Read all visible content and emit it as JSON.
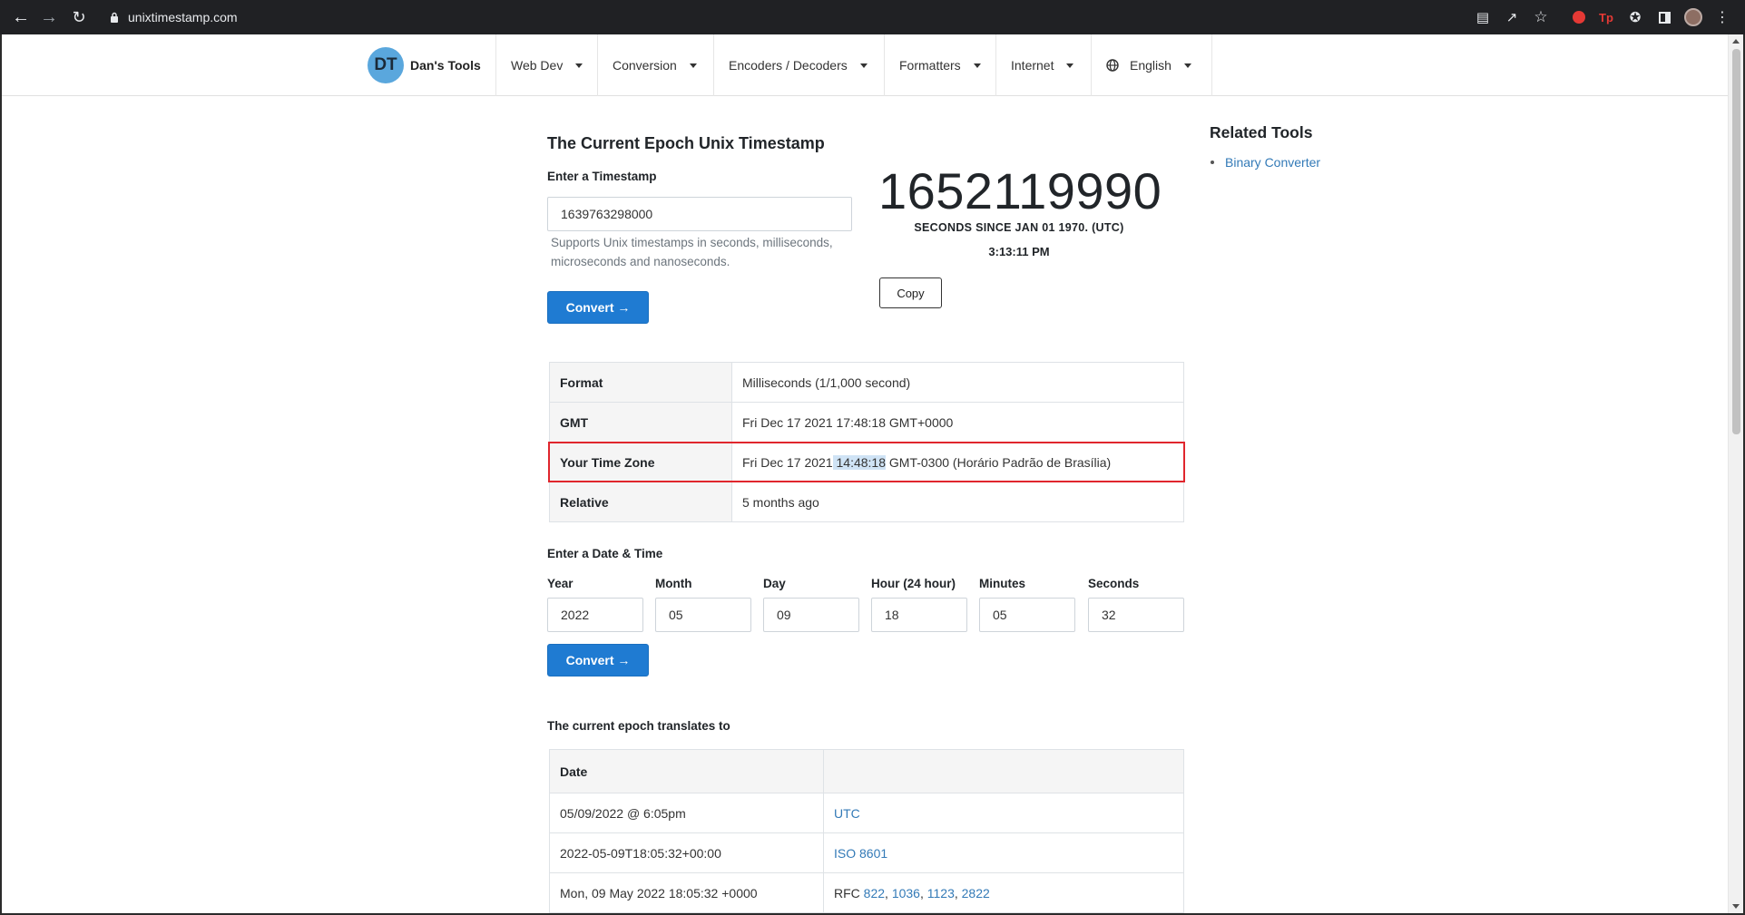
{
  "browser": {
    "url": "unixtimestamp.com"
  },
  "nav": {
    "logo": "DT",
    "brand": "Dan's Tools",
    "items": [
      "Web Dev",
      "Conversion",
      "Encoders / Decoders",
      "Formatters",
      "Internet",
      "English"
    ]
  },
  "main": {
    "title": "The Current Epoch Unix Timestamp",
    "timestamp_label": "Enter a Timestamp",
    "timestamp_value": "1639763298000",
    "help": "Supports Unix timestamps in seconds, milliseconds, microseconds and nanoseconds.",
    "convert_label": "Convert →",
    "epoch": "1652119990",
    "epoch_sub": "SECONDS SINCE JAN 01 1970. (UTC)",
    "epoch_time": "3:13:11 PM",
    "copy_label": "Copy"
  },
  "related": {
    "title": "Related Tools",
    "links": [
      "Binary Converter"
    ]
  },
  "results": [
    {
      "key": "Format",
      "value": "Milliseconds (1/1,000 second)"
    },
    {
      "key": "GMT",
      "value": "Fri Dec 17 2021 17:48:18 GMT+0000"
    },
    {
      "key": "Your Time Zone",
      "value_pre": "Fri Dec 17 2021",
      "value_hl": " 14:48:18",
      "value_post": " GMT-0300 (Horário Padrão de Brasília)"
    },
    {
      "key": "Relative",
      "value": "5 months ago"
    }
  ],
  "datetime": {
    "heading": "Enter a Date & Time",
    "fields": [
      {
        "label": "Year",
        "value": "2022"
      },
      {
        "label": "Month",
        "value": "05"
      },
      {
        "label": "Day",
        "value": "09"
      },
      {
        "label": "Hour (24 hour)",
        "value": "18"
      },
      {
        "label": "Minutes",
        "value": "05"
      },
      {
        "label": "Seconds",
        "value": "32"
      }
    ],
    "convert_label": "Convert →"
  },
  "translates": {
    "heading": "The current epoch translates to",
    "header": [
      "Date",
      ""
    ],
    "rows": [
      {
        "date": "05/09/2022 @ 6:05pm",
        "format": "UTC"
      },
      {
        "date": "2022-05-09T18:05:32+00:00",
        "format": "ISO 8601"
      },
      {
        "date": "Mon, 09 May 2022 18:05:32 +0000",
        "format_prefix": "RFC ",
        "rfc": [
          "822",
          "1036",
          "1123",
          "2822"
        ]
      }
    ]
  }
}
